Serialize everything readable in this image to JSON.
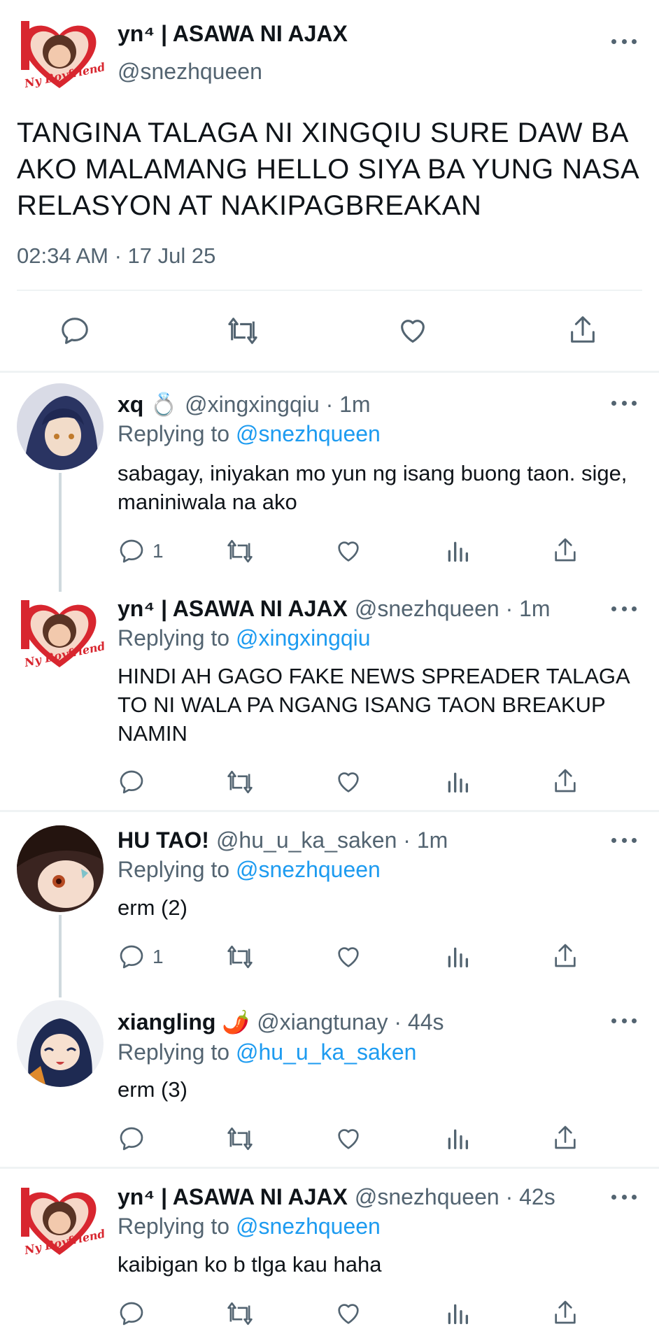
{
  "main_tweet": {
    "author_name": "yn⁴ | ASAWA NI AJAX",
    "author_handle": "@snezhqueen",
    "text": "TANGINA TALAGA NI XINGQIU SURE DAW BA AKO MALAMANG HELLO SIYA BA YUNG NASA RELASYON AT NAKIPAGBREAKAN",
    "timestamp": "02:34 AM · 17 Jul 25",
    "avatar_label": "Ny Boyfriend"
  },
  "replies": [
    {
      "name": "xq 💍",
      "handle_time": "@xingxingqiu · 1m",
      "replying_prefix": "Replying to ",
      "replying_to": "@snezhqueen",
      "text": "sabagay, iniyakan mo yun ng isang buong taon. sige, maniniwala na ako",
      "reply_count": "1"
    },
    {
      "name": "yn⁴ | ASAWA NI AJAX",
      "handle_time": "@snezhqueen · 1m",
      "replying_prefix": "Replying to ",
      "replying_to": "@xingxingqiu",
      "text": "HINDI AH GAGO FAKE NEWS SPREADER TALAGA TO NI WALA PA NGANG ISANG TAON BREAKUP NAMIN",
      "reply_count": ""
    },
    {
      "name": "HU TAO!",
      "handle_time": "@hu_u_ka_saken · 1m",
      "replying_prefix": "Replying to ",
      "replying_to": "@snezhqueen",
      "text": "erm (2)",
      "reply_count": "1"
    },
    {
      "name": "xiangling 🌶️",
      "handle_time": "@xiangtunay · 44s",
      "replying_prefix": "Replying to ",
      "replying_to": "@hu_u_ka_saken",
      "text": "erm (3)",
      "reply_count": ""
    },
    {
      "name": "yn⁴ | ASAWA NI AJAX",
      "handle_time": "@snezhqueen · 42s",
      "replying_prefix": "Replying to ",
      "replying_to": "@snezhqueen",
      "text": "kaibigan ko b tlga kau haha",
      "reply_count": ""
    }
  ],
  "colors": {
    "accent": "#1d9bf0",
    "secondary_text": "#536471",
    "heart_red": "#c8232e"
  }
}
